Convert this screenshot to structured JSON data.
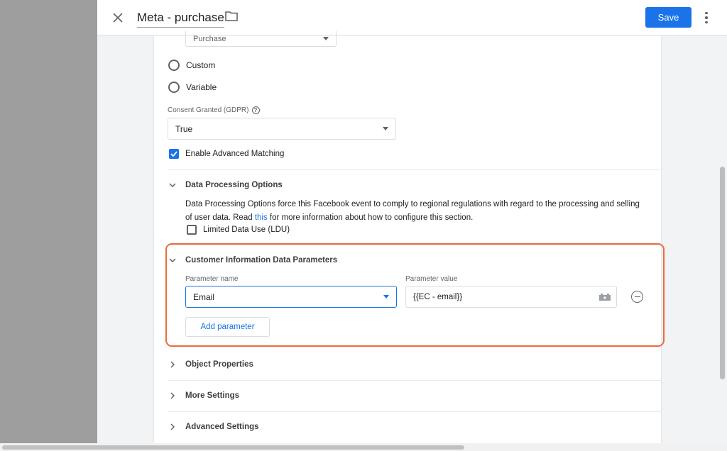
{
  "header": {
    "title": "Meta - purchase",
    "save_label": "Save"
  },
  "event": {
    "selected_partial": "Purchase"
  },
  "event_options": [
    {
      "label": "Custom"
    },
    {
      "label": "Variable"
    }
  ],
  "consent": {
    "label": "Consent Granted (GDPR)",
    "value": "True"
  },
  "advanced_matching": {
    "label": "Enable Advanced Matching",
    "checked": true
  },
  "data_processing": {
    "title": "Data Processing Options",
    "description_before": "Data Processing Options force this Facebook event to comply to regional regulations with regard to the processing and selling of user data. Read ",
    "link_text": "this",
    "description_after": " for more information about how to configure this section.",
    "ldu_label": "Limited Data Use (LDU)",
    "ldu_checked": false
  },
  "customer_info": {
    "title": "Customer Information Data Parameters",
    "param_name_label": "Parameter name",
    "param_value_label": "Parameter value",
    "param_name": "Email",
    "param_value": "{{EC - email}}",
    "add_label": "Add parameter"
  },
  "sections": {
    "object_properties": "Object Properties",
    "more_settings": "More Settings",
    "advanced_settings": "Advanced Settings"
  },
  "colors": {
    "primary": "#1a73e8",
    "highlight": "#ee6a3c"
  }
}
